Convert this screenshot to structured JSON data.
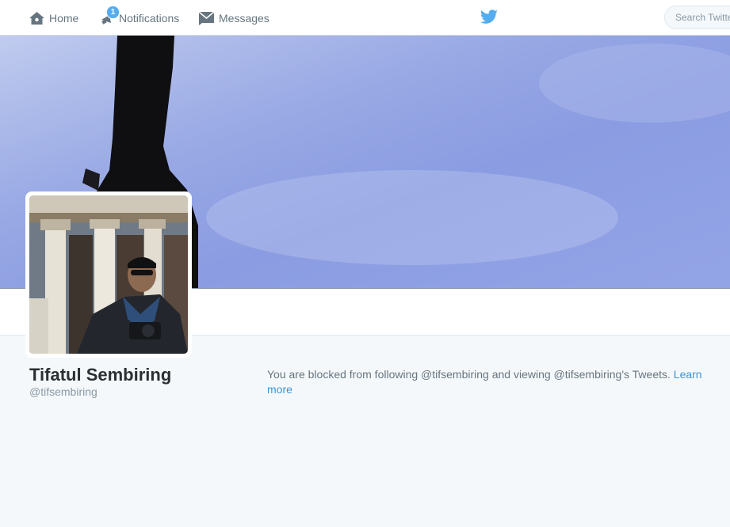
{
  "nav": {
    "home_label": "Home",
    "notifications_label": "Notifications",
    "notifications_count": "1",
    "messages_label": "Messages",
    "search_placeholder": "Search Twitter"
  },
  "profile": {
    "name": "Tifatul Sembiring",
    "handle": "@tifsembiring"
  },
  "blocked_notice": {
    "text": "You are blocked from following @tifsembiring and viewing @tifsembiring's Tweets. ",
    "link_text": "Learn more"
  },
  "colors": {
    "accent": "#55acee",
    "link": "#3b94d9",
    "text_muted": "#66757f"
  },
  "icons": [
    "home-icon",
    "notifications-icon",
    "messages-icon",
    "twitter-bird-icon"
  ]
}
